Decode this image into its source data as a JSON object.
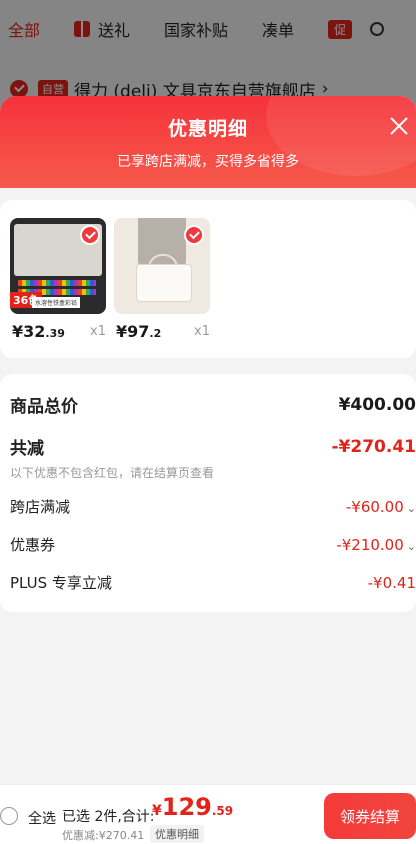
{
  "bg": {
    "tabs": [
      {
        "label": "全部"
      },
      {
        "label": "送礼"
      },
      {
        "label": "国家补贴"
      },
      {
        "label": "凑单"
      }
    ],
    "promo_badge": "促",
    "store": {
      "badge": "自营",
      "name": "得力 (deli) 文具京东自营旗舰店",
      "chevron": "›"
    }
  },
  "sheet": {
    "title": "优惠明细",
    "subtitle": "已享跨店满减，买得多省得多",
    "products": [
      {
        "price_int": "¥32",
        "price_dec": ".39",
        "qty": "x1",
        "tag": "36色",
        "caption": "水溶性铁盒彩铅"
      },
      {
        "price_int": "¥97",
        "price_dec": ".2",
        "qty": "x1"
      }
    ],
    "summary": {
      "total_label": "商品总价",
      "total_value": "¥400.00",
      "reduce_label": "共减",
      "reduce_value": "-¥270.41",
      "note": "以下优惠不包含红包，请在结算页查看",
      "items": [
        {
          "label": "跨店满减",
          "value": "-¥60.00"
        },
        {
          "label": "优惠券",
          "value": "-¥210.00"
        },
        {
          "label": "PLUS 专享立减",
          "value": "-¥0.41"
        }
      ]
    }
  },
  "bottom": {
    "select_all": "全选",
    "selected": "已选 2件,合计:",
    "currency": "¥",
    "total_int": "129",
    "total_dec": ".59",
    "discount": "优惠减:¥270.41",
    "detail_chip": "优惠明细",
    "checkout": "领券结算"
  },
  "colors": {
    "accent": "#e2231a",
    "header": "#f5323a"
  }
}
